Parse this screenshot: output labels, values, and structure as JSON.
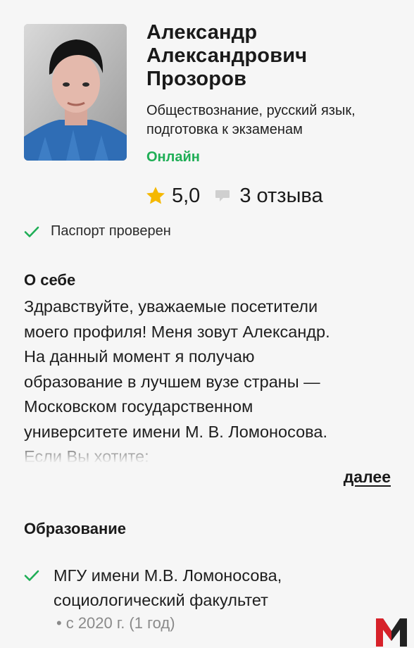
{
  "profile": {
    "name_lines": [
      "Александр",
      "Александрович",
      "Прозоров"
    ],
    "subjects_lines": [
      "Обществознание, русский язык,",
      "подготовка к экзаменам"
    ],
    "status": "Онлайн",
    "rating": "5,0",
    "reviews": "3 отзыва",
    "verified": "Паспорт проверен",
    "status_color": "#1fae56",
    "star_color": "#f5b800"
  },
  "about": {
    "title": "О себе",
    "lines": [
      "Здравствуйте, уважаемые посетители",
      "моего профиля! Меня зовут Александр.",
      "На данный момент я получаю",
      "образование в лучшем вузе страны —",
      "Московском государственном",
      "университете имени М. В. Ломоносова.",
      "Если Вы хотите:"
    ],
    "more_label": "далее"
  },
  "education": {
    "title": "Образование",
    "items": [
      {
        "lines": [
          "МГУ имени М.В. Ломоносова,",
          "социологический факультет"
        ],
        "period": "с 2020 г. (1 год)"
      }
    ]
  },
  "icons": {
    "verified": "check-icon",
    "rating": "star-icon",
    "reviews": "speech-bubble-icon",
    "logo": "m-logo-icon"
  }
}
